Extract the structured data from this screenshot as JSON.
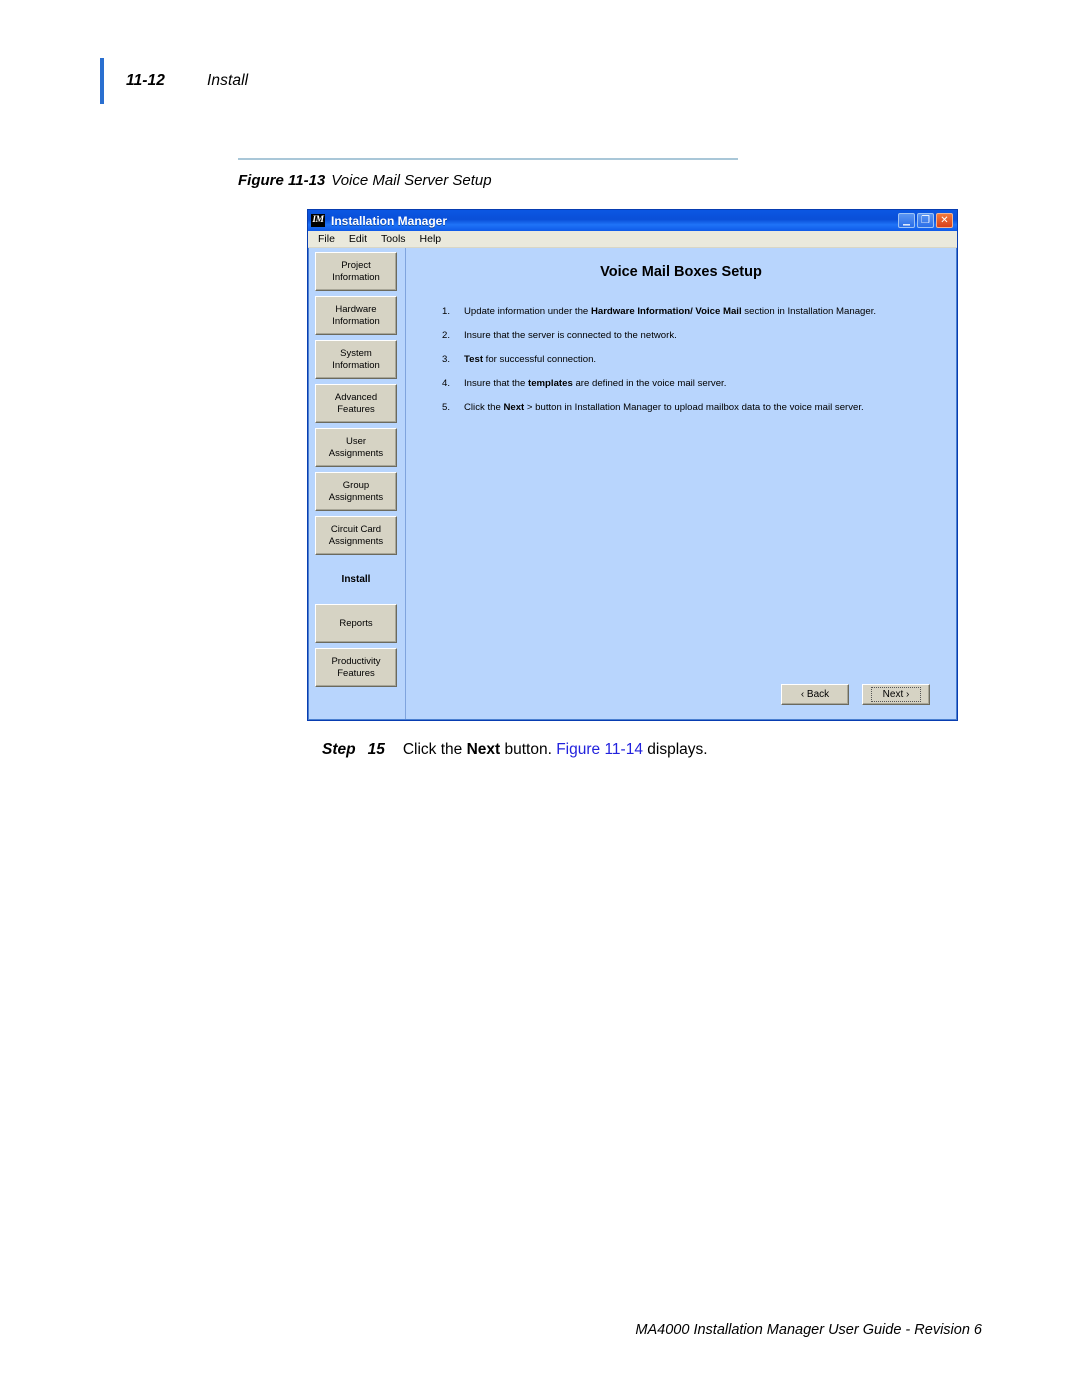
{
  "header": {
    "page_number": "11-12",
    "section_title": "Install"
  },
  "figure": {
    "label": "Figure 11-13",
    "name": "Voice Mail Server Setup"
  },
  "app_window": {
    "logo_text": "IM",
    "title": "Installation Manager",
    "window_controls": [
      {
        "name": "minimize",
        "glyph": "_"
      },
      {
        "name": "maximize",
        "glyph": "❐"
      },
      {
        "name": "close",
        "glyph": "✕"
      }
    ],
    "menubar": [
      "File",
      "Edit",
      "Tools",
      "Help"
    ],
    "sidebar": {
      "items": [
        {
          "line1": "Project",
          "line2": "Information",
          "selected": false
        },
        {
          "line1": "Hardware",
          "line2": "Information",
          "selected": false
        },
        {
          "line1": "System",
          "line2": "Information",
          "selected": false
        },
        {
          "line1": "Advanced",
          "line2": "Features",
          "selected": false
        },
        {
          "line1": "User",
          "line2": "Assignments",
          "selected": false
        },
        {
          "line1": "Group",
          "line2": "Assignments",
          "selected": false
        },
        {
          "line1": "Circuit Card",
          "line2": "Assignments",
          "selected": false
        },
        {
          "line1": "Install",
          "line2": "",
          "selected": true
        },
        {
          "line1": "Reports",
          "line2": "",
          "selected": false
        },
        {
          "line1": "Productivity",
          "line2": "Features",
          "selected": false
        }
      ]
    },
    "content": {
      "title": "Voice Mail Boxes Setup",
      "steps": [
        {
          "num": "1.",
          "pre": "Update information under the ",
          "bold": "Hardware Information/ Voice Mail",
          "post": " section in Installation Manager."
        },
        {
          "num": "2.",
          "pre": "Insure that the server is connected to the network.",
          "bold": "",
          "post": ""
        },
        {
          "num": "3.",
          "pre": "",
          "bold": "Test",
          "post": " for successful connection."
        },
        {
          "num": "4.",
          "pre": "Insure that the ",
          "bold": "templates",
          "post": " are defined in the voice mail server."
        },
        {
          "num": "5.",
          "pre": "Click the ",
          "bold": "Next",
          "post": " > button in Installation Manager to upload mailbox data to the voice mail server."
        }
      ],
      "buttons": {
        "back": "‹ Back",
        "next": "Next ›"
      }
    }
  },
  "step_instruction": {
    "step_word": "Step",
    "step_number": "15",
    "text_before": "Click the ",
    "bold_word": "Next",
    "text_middle": " button. ",
    "cross_reference": "Figure 11-14",
    "text_after": " displays."
  },
  "footer": {
    "text": "MA4000 Installation Manager User Guide - Revision 6"
  },
  "colors": {
    "accent_blue": "#2a6fd0",
    "titlebar_blue": "#0b4fd8",
    "content_blue": "#b8d5fd",
    "menubar_cream": "#eae9dc",
    "button_gray": "#d6d3c4",
    "xref_blue": "#2222dd",
    "rule_blue": "#a9c7d8"
  }
}
